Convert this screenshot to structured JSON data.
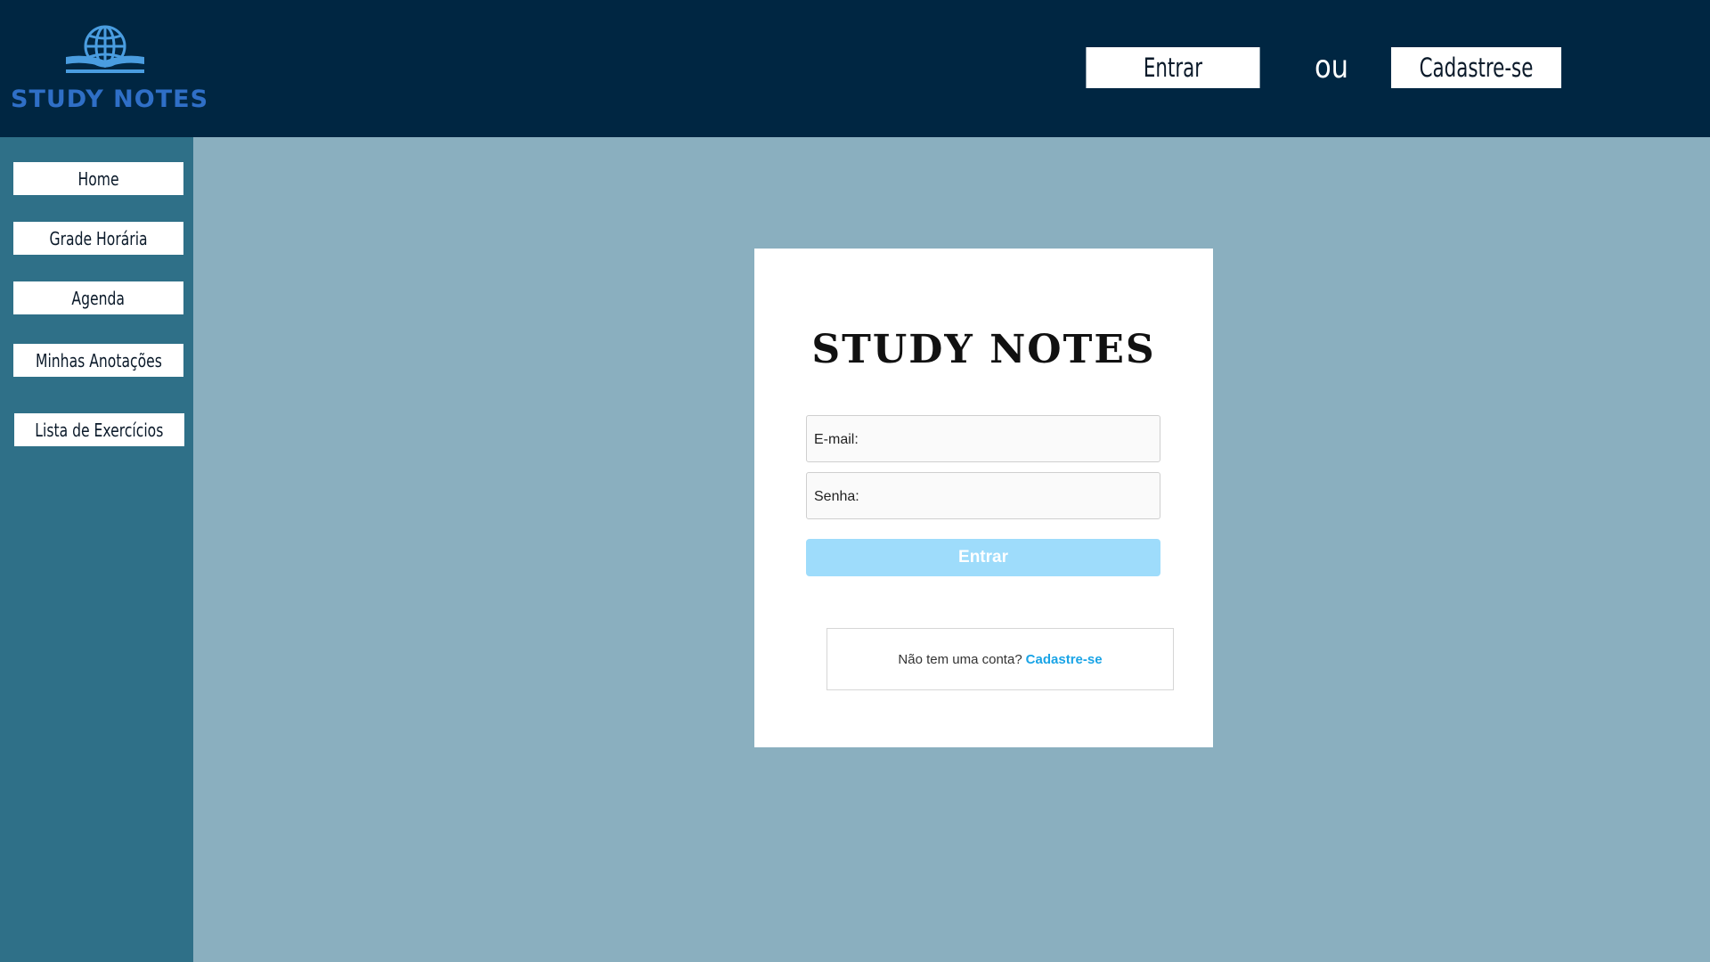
{
  "header": {
    "logo_text": "STUDY NOTES",
    "login_button": "Entrar",
    "or_text": "ou",
    "signup_button": "Cadastre-se"
  },
  "sidebar": {
    "items": [
      {
        "label": "Home"
      },
      {
        "label": "Grade Horária"
      },
      {
        "label": "Agenda"
      },
      {
        "label": "Minhas Anotações"
      },
      {
        "label": "Lista de Exercícios"
      }
    ]
  },
  "login_card": {
    "title": "STUDY NOTES",
    "email_label": "E-mail:",
    "email_value": "",
    "password_label": "Senha:",
    "password_value": "",
    "submit_label": "Entrar",
    "no_account_text": "Não tem uma conta?",
    "signup_link": "Cadastre-se"
  },
  "colors": {
    "header_bg": "#002642",
    "sidebar_bg": "#2f7088",
    "main_bg": "#8aafbf",
    "logo_blue": "#2f6fc7",
    "submit_button": "#9edcfb",
    "link_blue": "#1aa4e6"
  },
  "icons": {
    "logo": "globe-book-icon"
  }
}
